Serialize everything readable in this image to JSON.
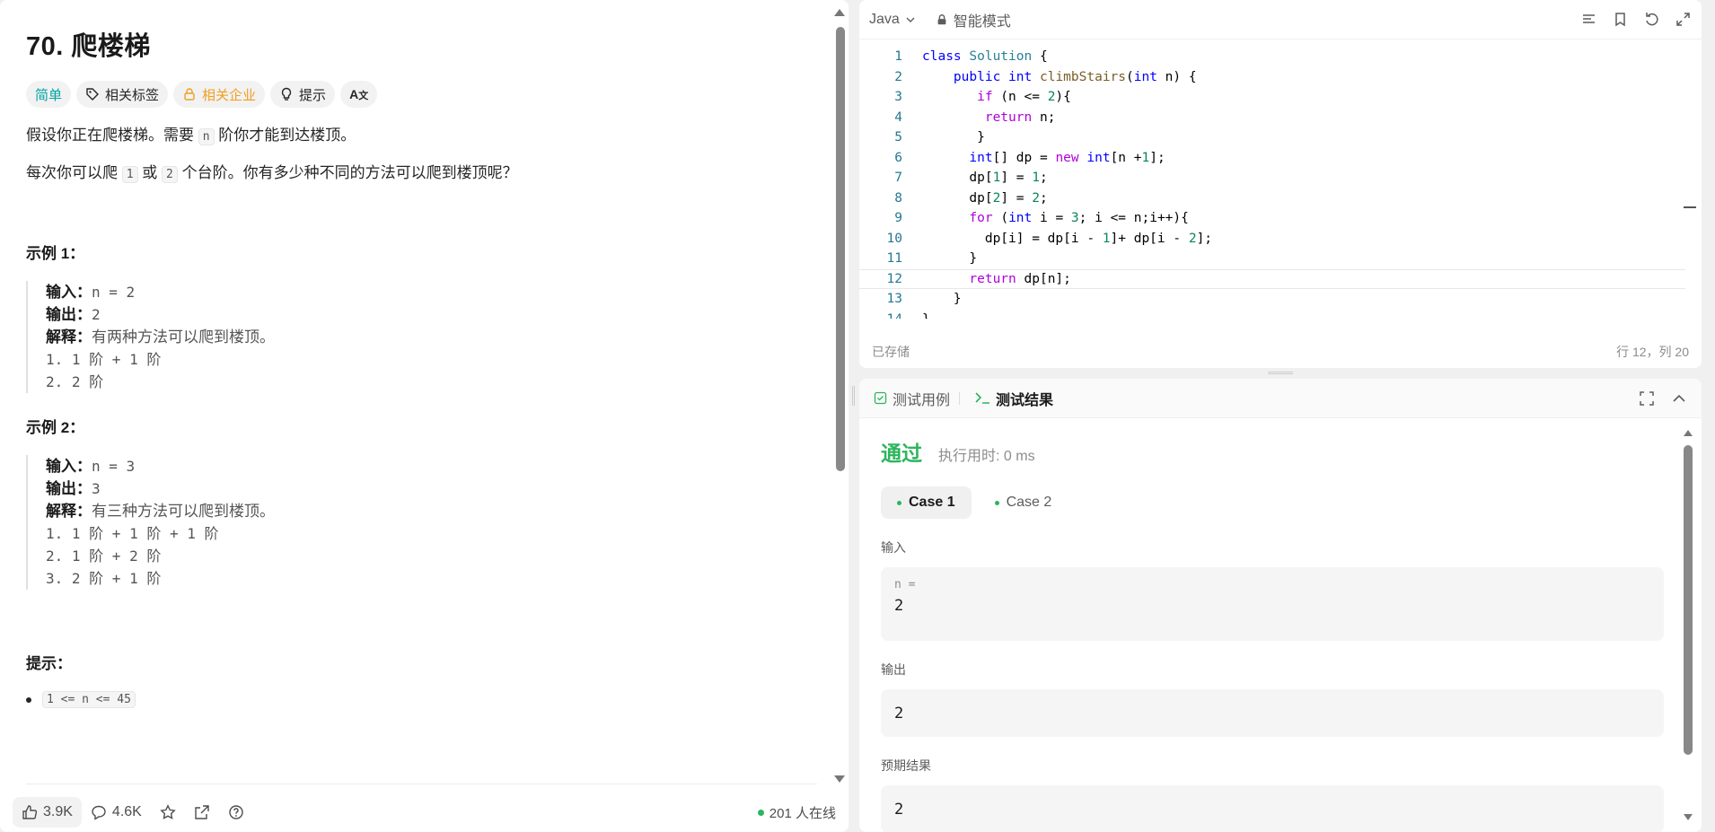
{
  "problem": {
    "title": "70. 爬楼梯",
    "tags": {
      "difficulty": "简单",
      "related_tags": "相关标签",
      "related_companies": "相关企业",
      "hint": "提示",
      "translate": "A文"
    },
    "desc_1_pre": "假设你正在爬楼梯。需要",
    "desc_1_code": "n",
    "desc_1_post": "阶你才能到达楼顶。",
    "desc_2_pre": "每次你可以爬",
    "desc_2_code_a": "1",
    "desc_2_mid": "或",
    "desc_2_code_b": "2",
    "desc_2_post": "个台阶。你有多少种不同的方法可以爬到楼顶呢？",
    "examples": [
      {
        "title": "示例 1：",
        "input_label": "输入：",
        "input": "n = 2",
        "output_label": "输出：",
        "output": "2",
        "explain_label": "解释：",
        "explain": "有两种方法可以爬到楼顶。",
        "steps": [
          "1. 1 阶 + 1 阶",
          "2. 2 阶"
        ]
      },
      {
        "title": "示例 2：",
        "input_label": "输入：",
        "input": "n = 3",
        "output_label": "输出：",
        "output": "3",
        "explain_label": "解释：",
        "explain": "有三种方法可以爬到楼顶。",
        "steps": [
          "1. 1 阶 + 1 阶 + 1 阶",
          "2. 1 阶 + 2 阶",
          "3. 2 阶 + 1 阶"
        ]
      }
    ],
    "hints_title": "提示：",
    "constraint": "1 <= n <= 45"
  },
  "footer": {
    "likes": "3.9K",
    "comments": "4.6K",
    "online": "201 人在线"
  },
  "editor": {
    "language": "Java",
    "mode": "智能模式",
    "saved": "已存储",
    "cursor": "行 12，列 20"
  },
  "results": {
    "tab_cases": "测试用例",
    "tab_result": "测试结果",
    "verdict": "通过",
    "runtime": "执行用时: 0 ms",
    "case_1": "Case 1",
    "case_2": "Case 2",
    "input_label": "输入",
    "input_var": "n =",
    "input_value": "2",
    "output_label": "输出",
    "output_value": "2",
    "expected_label": "预期结果",
    "expected_value": "2"
  },
  "colors": {
    "pass_green": "#2db55d",
    "easy_teal": "#00a3a3",
    "company_orange": "#f0a020"
  }
}
